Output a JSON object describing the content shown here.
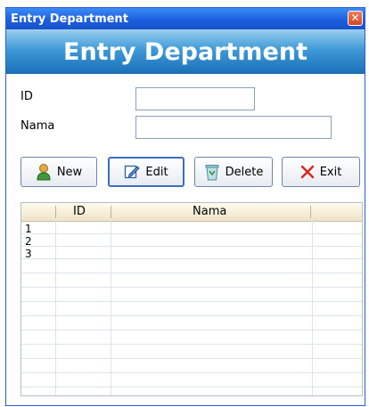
{
  "window": {
    "title": "Entry Department",
    "close_label": "✕"
  },
  "banner": {
    "title": "Entry Department"
  },
  "form": {
    "id_label": "ID",
    "id_value": "",
    "nama_label": "Nama",
    "nama_value": ""
  },
  "toolbar": {
    "new_label": "New",
    "edit_label": "Edit",
    "delete_label": "Delete",
    "exit_label": "Exit"
  },
  "grid": {
    "columns": [
      "ID",
      "Nama"
    ],
    "rows": [
      {
        "num": "1",
        "id": "",
        "nama": ""
      },
      {
        "num": "2",
        "id": "",
        "nama": ""
      },
      {
        "num": "3",
        "id": "",
        "nama": ""
      }
    ]
  },
  "colors": {
    "titlebar": "#1c5fe0",
    "banner": "#3f9ad8",
    "grid_header": "#efe3c8"
  }
}
